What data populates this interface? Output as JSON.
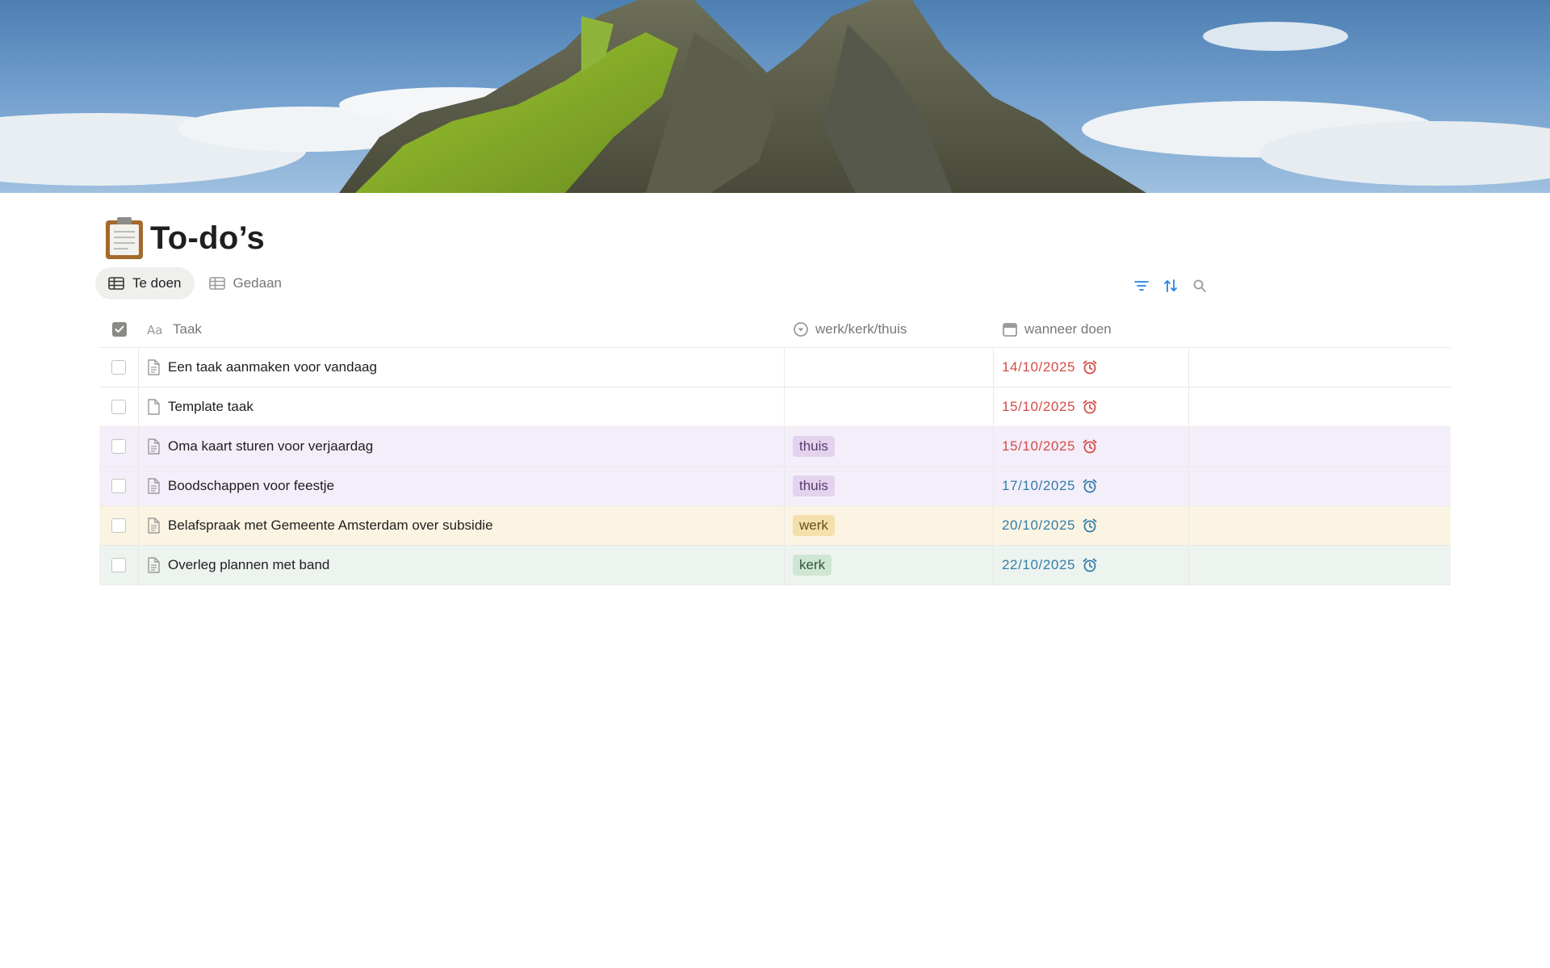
{
  "page": {
    "title": "To-do’s",
    "icon": "clipboard-icon",
    "cover": "mountain-island-cover-image"
  },
  "views": [
    {
      "label": "Te doen",
      "icon": "table-icon",
      "active": true
    },
    {
      "label": "Gedaan",
      "icon": "table-icon",
      "active": false
    }
  ],
  "toolbar": {
    "filter_icon": "filter-icon",
    "sort_icon": "sort-icon",
    "search_icon": "search-icon",
    "accent": "#2383e2"
  },
  "columns": {
    "task": "Taak",
    "category": "werk/kerk/thuis",
    "due": "wanneer doen"
  },
  "rows": [
    {
      "title": "Een taak aanmaken voor vandaag",
      "tag": "",
      "date": "14/10/2025",
      "overdue": true
    },
    {
      "title": "Template taak",
      "tag": "",
      "date": "15/10/2025",
      "overdue": true
    },
    {
      "title": "Oma kaart sturen voor verjaardag",
      "tag": "thuis",
      "date": "15/10/2025",
      "overdue": true
    },
    {
      "title": "Boodschappen voor feestje",
      "tag": "thuis",
      "date": "17/10/2025",
      "overdue": false
    },
    {
      "title": "Belafspraak met Gemeente Amsterdam over subsidie",
      "tag": "werk",
      "date": "20/10/2025",
      "overdue": false
    },
    {
      "title": "Overleg plannen met band",
      "tag": "kerk",
      "date": "22/10/2025",
      "overdue": false
    }
  ],
  "colors": {
    "overdue": "#d44c47",
    "upcoming": "#337ea9",
    "thuis_row": "#f4eefa",
    "werk_row": "#fbf4e3",
    "kerk_row": "#edf3ee"
  }
}
